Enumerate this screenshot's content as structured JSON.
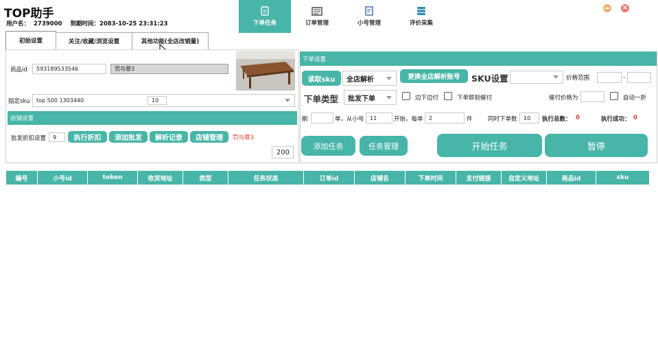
{
  "app": {
    "title": "TOP助手",
    "username_label": "用户名：",
    "username": "2739000",
    "expire_label": "到期时间：",
    "expire": "2083-10-25 23:31:23"
  },
  "nav": [
    {
      "label": "下单任务",
      "icon": "task-icon",
      "active": true
    },
    {
      "label": "订单管理",
      "icon": "order-icon",
      "active": false
    },
    {
      "label": "小号管理",
      "icon": "account-icon",
      "active": false
    },
    {
      "label": "评价采集",
      "icon": "database-icon",
      "active": false
    }
  ],
  "tabs": [
    "初始设置",
    "关注/收藏/浏览设置",
    "其他功能(全店改销量)"
  ],
  "left": {
    "product_id_label": "商品id",
    "product_id": "593189533546",
    "product_name": "罚与罪3",
    "sku_label": "指定sku",
    "sku_value": "top 500 1303440",
    "sku_qty": "10",
    "shop_section_title": "店铺设置",
    "batch_label": "批发折扣设置",
    "batch_value": "9",
    "btn_exec_discount": "执行折扣",
    "btn_add_batch": "添加批发",
    "btn_parse_log": "解析记录",
    "btn_shop_manage": "店铺管理",
    "shop_name": "罚与罪3",
    "count_value": "200"
  },
  "right": {
    "section_title": "下单设置",
    "btn_read_sku": "读取sku",
    "parse_mode": "全店解析",
    "btn_replace_account": "更换全店解析账号",
    "sku_setting_label": "SKU设置",
    "price_range_label": "价格范围",
    "price_min": "",
    "price_sep": "-",
    "price_max": "",
    "order_type_label": "下单类型",
    "order_type": "批发下单",
    "chk_pay_while_order": "边下边付",
    "chk_pay_immediately": "下单即刻催付",
    "remind_price_label": "催付价格为",
    "remind_price": "",
    "chk_auto_discount": "自动一折",
    "brush_label": "刷",
    "brush_value": "",
    "from_label": "单，从小号",
    "from_value": "11",
    "start_label": "开始，每单",
    "per_order_value": "2",
    "piece_label": "件",
    "concurrent_label": "同时下单数",
    "concurrent_value": "10",
    "total_label": "执行总数：",
    "total_value": "0",
    "success_label": "执行成功：",
    "success_value": "0",
    "btn_add_task": "添加任务",
    "btn_task_manage": "任务管理",
    "btn_start": "开始任务",
    "btn_pause": "暂停"
  },
  "table": {
    "columns": [
      "编号",
      "小号id",
      "token",
      "收货地址",
      "类型",
      "任务状态",
      "订单id",
      "店铺名",
      "下单时间",
      "支付链接",
      "自定义地址",
      "商品id",
      "sku"
    ],
    "rows": []
  },
  "colors": {
    "accent": "#47b5a8",
    "red": "#e03c2c"
  }
}
